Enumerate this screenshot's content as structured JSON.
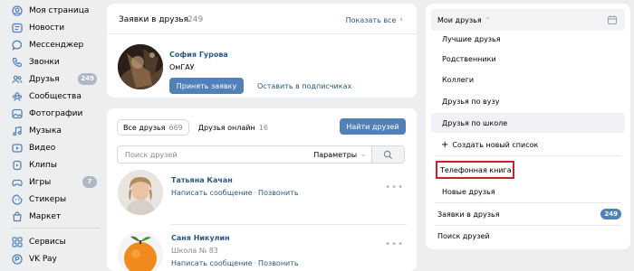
{
  "sidebar": {
    "items": [
      {
        "label": "Моя страница",
        "icon": "user-circle-icon"
      },
      {
        "label": "Новости",
        "icon": "news-icon"
      },
      {
        "label": "Мессенджер",
        "icon": "message-icon"
      },
      {
        "label": "Звонки",
        "icon": "phone-icon"
      },
      {
        "label": "Друзья",
        "icon": "friends-icon",
        "badge": "249"
      },
      {
        "label": "Сообщества",
        "icon": "communities-icon"
      },
      {
        "label": "Фотографии",
        "icon": "photo-icon"
      },
      {
        "label": "Музыка",
        "icon": "music-icon"
      },
      {
        "label": "Видео",
        "icon": "video-icon"
      },
      {
        "label": "Клипы",
        "icon": "clips-icon"
      },
      {
        "label": "Игры",
        "icon": "games-icon",
        "badge": "7"
      },
      {
        "label": "Стикеры",
        "icon": "stickers-icon"
      },
      {
        "label": "Маркет",
        "icon": "market-icon"
      },
      {
        "label": "Сервисы",
        "icon": "services-icon"
      },
      {
        "label": "VK Pay",
        "icon": "vkpay-icon"
      }
    ]
  },
  "requests": {
    "title": "Заявки в друзья",
    "count": "249",
    "show_all": "Показать все",
    "request": {
      "name": "София Гурова",
      "subtitle": "ОмГАУ",
      "accept_label": "Принять заявку",
      "subscribers_label": "Оставить в подписчиках"
    }
  },
  "friends": {
    "tab_all_label": "Все друзья",
    "tab_all_count": "669",
    "tab_online_label": "Друзья онлайн",
    "tab_online_count": "16",
    "find_button": "Найти друзей",
    "search_placeholder": "Поиск друзей",
    "params_label": "Параметры",
    "list": [
      {
        "name": "Татьяна Качан",
        "subtitle": "",
        "write": "Написать сообщение",
        "call": "Позвонить"
      },
      {
        "name": "Саня Никулин",
        "subtitle": "Школа № 83",
        "write": "Написать сообщение",
        "call": "Позвонить"
      }
    ]
  },
  "right_menu": {
    "header": "Мои друзья",
    "items": [
      "Лучшие друзья",
      "Родственники",
      "Коллеги",
      "Друзья по вузу",
      "Друзья по школе"
    ],
    "create_list": "Создать новый список",
    "phone_book": "Телефонная книга",
    "new_friends": "Новые друзья",
    "requests_label": "Заявки в друзья",
    "requests_count": "249",
    "search_friends": "Поиск друзей"
  },
  "colors": {
    "accent": "#5181b8",
    "link": "#2a5885",
    "background": "#edeef0",
    "highlight_border": "#cc1f2c"
  }
}
